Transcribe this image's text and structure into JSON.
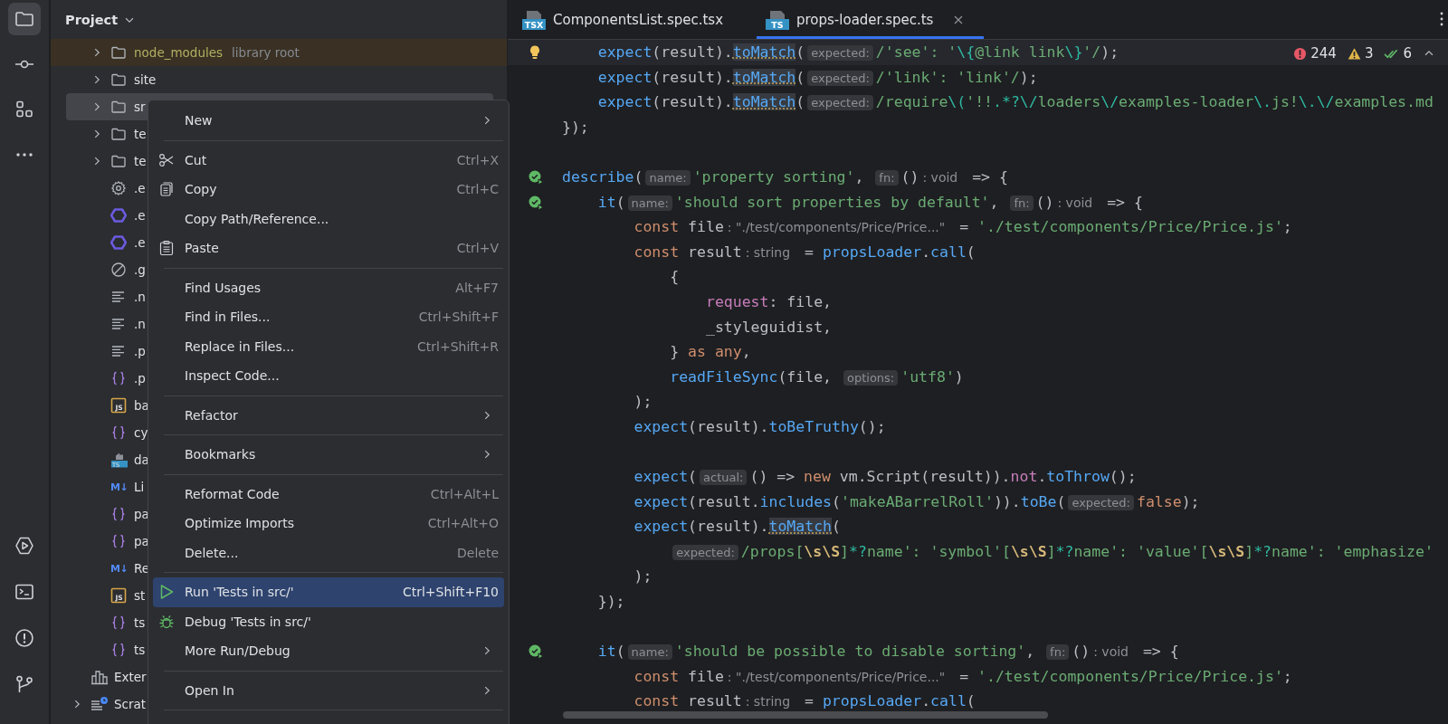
{
  "tool_strip": {
    "top": [
      {
        "kind": "project",
        "selected": true
      },
      {
        "kind": "commit",
        "selected": false
      },
      {
        "kind": "structure",
        "selected": false
      },
      {
        "kind": "more",
        "selected": false
      }
    ],
    "bottom": [
      {
        "kind": "run",
        "selected": false
      },
      {
        "kind": "terminal",
        "selected": false
      },
      {
        "kind": "problems",
        "selected": false
      },
      {
        "kind": "git",
        "selected": false
      }
    ]
  },
  "project": {
    "title": "Project",
    "items": [
      {
        "kind": "folder",
        "label": "node_modules",
        "note": "library root",
        "library": true,
        "expanded": false,
        "selected": false
      },
      {
        "kind": "folder",
        "label": "site",
        "library": false,
        "expanded": false,
        "selected": false
      },
      {
        "kind": "folder",
        "label": "sr",
        "library": false,
        "expanded": false,
        "selected": true
      },
      {
        "kind": "folder",
        "label": "te",
        "library": false,
        "expanded": false,
        "selected": false
      },
      {
        "kind": "folder",
        "label": "te",
        "library": false,
        "expanded": false,
        "selected": false
      },
      {
        "kind": "gear",
        "label": ".e",
        "library": false,
        "selected": false
      },
      {
        "kind": "hex",
        "label": ".e",
        "library": false,
        "selected": false
      },
      {
        "kind": "hex",
        "label": ".e",
        "library": false,
        "selected": false
      },
      {
        "kind": "block",
        "label": ".g",
        "library": false,
        "selected": false
      },
      {
        "kind": "lines",
        "label": ".n",
        "library": false,
        "selected": false
      },
      {
        "kind": "lines",
        "label": ".n",
        "library": false,
        "selected": false
      },
      {
        "kind": "lines",
        "label": ".p",
        "library": false,
        "selected": false
      },
      {
        "kind": "braces",
        "label": ".p",
        "library": false,
        "selected": false
      },
      {
        "kind": "js",
        "icon_text": "JS",
        "label": "ba",
        "library": false,
        "selected": false
      },
      {
        "kind": "braces",
        "label": "cy",
        "library": false,
        "selected": false
      },
      {
        "kind": "tsdb",
        "icon_text": "TS",
        "label": "da",
        "library": false,
        "selected": false
      },
      {
        "kind": "md",
        "icon_text": "M↓",
        "label": "Li",
        "library": false,
        "selected": false
      },
      {
        "kind": "braces",
        "label": "pa",
        "library": false,
        "selected": false
      },
      {
        "kind": "braces",
        "label": "pa",
        "library": false,
        "selected": false
      },
      {
        "kind": "md",
        "icon_text": "M↓",
        "label": "Re",
        "library": false,
        "selected": false
      },
      {
        "kind": "js",
        "icon_text": "JS",
        "label": "st",
        "library": false,
        "selected": false
      },
      {
        "kind": "braces",
        "label": "ts",
        "library": false,
        "selected": false
      },
      {
        "kind": "braces",
        "label": "ts",
        "library": false,
        "selected": false
      }
    ],
    "root_items": [
      {
        "kind": "library",
        "label": "Exter",
        "selected": false
      },
      {
        "kind": "scratch",
        "label": "Scrat",
        "expanded": false,
        "selected": false
      }
    ]
  },
  "editor": {
    "tabs": [
      {
        "label": "ComponentsList.spec.tsx",
        "icon_text": "TSX",
        "selected": false,
        "closable": false
      },
      {
        "label": "props-loader.spec.ts",
        "icon_text": "TS",
        "selected": true,
        "closable": true
      }
    ],
    "issues": {
      "errors": "244",
      "warnings": "3",
      "passed": "6"
    },
    "lines": [
      {
        "kind": "bulb",
        "current": true,
        "tokens": [
          {
            "kind": "fn",
            "text": "    expect"
          },
          {
            "kind": "plain",
            "text": "(result)."
          },
          {
            "kind": "match",
            "text": "toMatch"
          },
          {
            "kind": "plain",
            "text": "("
          },
          {
            "kind": "hint",
            "text": "expected:"
          },
          {
            "kind": "str",
            "text": "/'see': '"
          },
          {
            "kind": "esc",
            "text": "\\{"
          },
          {
            "kind": "str",
            "text": "@link link"
          },
          {
            "kind": "esc",
            "text": "\\}"
          },
          {
            "kind": "str",
            "text": "'/"
          },
          {
            "kind": "plain",
            "text": ");"
          }
        ]
      },
      {
        "kind": "code",
        "current": false,
        "tokens": [
          {
            "kind": "fn",
            "text": "    expect"
          },
          {
            "kind": "plain",
            "text": "(result)."
          },
          {
            "kind": "match",
            "text": "toMatch"
          },
          {
            "kind": "plain",
            "text": "("
          },
          {
            "kind": "hint",
            "text": "expected:"
          },
          {
            "kind": "str",
            "text": "/'link': 'link'/"
          },
          {
            "kind": "plain",
            "text": ");"
          }
        ]
      },
      {
        "kind": "code",
        "current": false,
        "tokens": [
          {
            "kind": "fn",
            "text": "    expect"
          },
          {
            "kind": "plain",
            "text": "(result)."
          },
          {
            "kind": "match",
            "text": "toMatch"
          },
          {
            "kind": "plain",
            "text": "("
          },
          {
            "kind": "hint",
            "text": "expected:"
          },
          {
            "kind": "str",
            "text": "/require"
          },
          {
            "kind": "esc",
            "text": "\\("
          },
          {
            "kind": "str",
            "text": "'!!"
          },
          {
            "kind": "esc",
            "text": ".*?\\/"
          },
          {
            "kind": "str",
            "text": "loaders"
          },
          {
            "kind": "esc",
            "text": "\\/"
          },
          {
            "kind": "str",
            "text": "examples-loader"
          },
          {
            "kind": "esc",
            "text": "\\."
          },
          {
            "kind": "str",
            "text": "js!"
          },
          {
            "kind": "esc",
            "text": "\\.\\/"
          },
          {
            "kind": "str",
            "text": "examples.md"
          }
        ]
      },
      {
        "kind": "code",
        "current": false,
        "tokens": [
          {
            "kind": "plain",
            "text": "});"
          }
        ]
      },
      {
        "kind": "code",
        "current": false
      },
      {
        "kind": "run",
        "current": false,
        "tokens": [
          {
            "kind": "fn",
            "text": "describe"
          },
          {
            "kind": "plain",
            "text": "("
          },
          {
            "kind": "hint",
            "text": "name:"
          },
          {
            "kind": "str",
            "text": "'property sorting'"
          },
          {
            "kind": "plain",
            "text": ", "
          },
          {
            "kind": "hint",
            "text": "fn:"
          },
          {
            "kind": "plain",
            "text": "()"
          },
          {
            "kind": "type",
            "text": ": void"
          },
          {
            "kind": "plain",
            "text": " => {"
          }
        ]
      },
      {
        "kind": "run",
        "current": false,
        "tokens": [
          {
            "kind": "fn",
            "text": "    it"
          },
          {
            "kind": "plain",
            "text": "("
          },
          {
            "kind": "hint",
            "text": "name:"
          },
          {
            "kind": "str",
            "text": "'should sort properties by default'"
          },
          {
            "kind": "plain",
            "text": ", "
          },
          {
            "kind": "hint",
            "text": "fn:"
          },
          {
            "kind": "plain",
            "text": "()"
          },
          {
            "kind": "type",
            "text": ": void"
          },
          {
            "kind": "plain",
            "text": " => {"
          }
        ]
      },
      {
        "kind": "code",
        "current": false,
        "tokens": [
          {
            "kind": "kw",
            "text": "        const"
          },
          {
            "kind": "plain",
            "text": " file"
          },
          {
            "kind": "type",
            "text": ": \"./test/components/Price/Price...\""
          },
          {
            "kind": "plain",
            "text": " = "
          },
          {
            "kind": "str",
            "text": "'./test/components/Price/Price.js'"
          },
          {
            "kind": "plain",
            "text": ";"
          }
        ]
      },
      {
        "kind": "code",
        "current": false,
        "tokens": [
          {
            "kind": "kw",
            "text": "        const"
          },
          {
            "kind": "plain",
            "text": " result"
          },
          {
            "kind": "type",
            "text": ": string"
          },
          {
            "kind": "plain",
            "text": " = "
          },
          {
            "kind": "fn",
            "text": "propsLoader"
          },
          {
            "kind": "plain",
            "text": "."
          },
          {
            "kind": "fn",
            "text": "call"
          },
          {
            "kind": "plain",
            "text": "("
          }
        ]
      },
      {
        "kind": "code",
        "current": false,
        "tokens": [
          {
            "kind": "plain",
            "text": "            {"
          }
        ]
      },
      {
        "kind": "code",
        "current": false,
        "tokens": [
          {
            "kind": "prop",
            "text": "                request"
          },
          {
            "kind": "plain",
            "text": ": file,"
          }
        ]
      },
      {
        "kind": "code",
        "current": false,
        "tokens": [
          {
            "kind": "plain",
            "text": "                _styleguidist,"
          }
        ]
      },
      {
        "kind": "code",
        "current": false,
        "tokens": [
          {
            "kind": "plain",
            "text": "            } "
          },
          {
            "kind": "kw",
            "text": "as any"
          },
          {
            "kind": "plain",
            "text": ","
          }
        ]
      },
      {
        "kind": "code",
        "current": false,
        "tokens": [
          {
            "kind": "fn",
            "text": "            readFileSync"
          },
          {
            "kind": "plain",
            "text": "(file, "
          },
          {
            "kind": "hint",
            "text": "options:"
          },
          {
            "kind": "str",
            "text": "'utf8'"
          },
          {
            "kind": "plain",
            "text": ")"
          }
        ]
      },
      {
        "kind": "code",
        "current": false,
        "tokens": [
          {
            "kind": "plain",
            "text": "        );"
          }
        ]
      },
      {
        "kind": "code",
        "current": false,
        "tokens": [
          {
            "kind": "fn",
            "text": "        expect"
          },
          {
            "kind": "plain",
            "text": "(result)."
          },
          {
            "kind": "fn",
            "text": "toBeTruthy"
          },
          {
            "kind": "plain",
            "text": "();"
          }
        ]
      },
      {
        "kind": "code",
        "current": false
      },
      {
        "kind": "code",
        "current": false,
        "tokens": [
          {
            "kind": "fn",
            "text": "        expect"
          },
          {
            "kind": "plain",
            "text": "("
          },
          {
            "kind": "hint",
            "text": "actual:"
          },
          {
            "kind": "plain",
            "text": "() => "
          },
          {
            "kind": "kw",
            "text": "new"
          },
          {
            "kind": "plain",
            "text": " vm.Script(result))."
          },
          {
            "kind": "prop",
            "text": "not"
          },
          {
            "kind": "plain",
            "text": "."
          },
          {
            "kind": "fn",
            "text": "toThrow"
          },
          {
            "kind": "plain",
            "text": "();"
          }
        ]
      },
      {
        "kind": "code",
        "current": false,
        "tokens": [
          {
            "kind": "fn",
            "text": "        expect"
          },
          {
            "kind": "plain",
            "text": "(result."
          },
          {
            "kind": "fn",
            "text": "includes"
          },
          {
            "kind": "plain",
            "text": "("
          },
          {
            "kind": "str",
            "text": "'makeABarrelRoll'"
          },
          {
            "kind": "plain",
            "text": "))."
          },
          {
            "kind": "fn",
            "text": "toBe"
          },
          {
            "kind": "plain",
            "text": "("
          },
          {
            "kind": "hint",
            "text": "expected:"
          },
          {
            "kind": "kw",
            "text": "false"
          },
          {
            "kind": "plain",
            "text": ");"
          }
        ]
      },
      {
        "kind": "code",
        "current": false,
        "tokens": [
          {
            "kind": "fn",
            "text": "        expect"
          },
          {
            "kind": "plain",
            "text": "(result)."
          },
          {
            "kind": "match",
            "text": "toMatch"
          },
          {
            "kind": "plain",
            "text": "("
          }
        ]
      },
      {
        "kind": "code",
        "current": false,
        "tokens": [
          {
            "kind": "hint",
            "text": "            expected:"
          },
          {
            "kind": "str",
            "text": "/props["
          },
          {
            "kind": "cls",
            "text": "\\s\\S"
          },
          {
            "kind": "str",
            "text": "]"
          },
          {
            "kind": "esc",
            "text": "*?"
          },
          {
            "kind": "str",
            "text": "name': 'symbol'["
          },
          {
            "kind": "cls",
            "text": "\\s\\S"
          },
          {
            "kind": "str",
            "text": "]"
          },
          {
            "kind": "esc",
            "text": "*?"
          },
          {
            "kind": "str",
            "text": "name': 'value'["
          },
          {
            "kind": "cls",
            "text": "\\s\\S"
          },
          {
            "kind": "str",
            "text": "]"
          },
          {
            "kind": "esc",
            "text": "*?"
          },
          {
            "kind": "str",
            "text": "name': 'emphasize'"
          }
        ]
      },
      {
        "kind": "code",
        "current": false,
        "tokens": [
          {
            "kind": "plain",
            "text": "        );"
          }
        ]
      },
      {
        "kind": "code",
        "current": false,
        "tokens": [
          {
            "kind": "plain",
            "text": "    });"
          }
        ]
      },
      {
        "kind": "code",
        "current": false
      },
      {
        "kind": "run",
        "current": false,
        "tokens": [
          {
            "kind": "fn",
            "text": "    it"
          },
          {
            "kind": "plain",
            "text": "("
          },
          {
            "kind": "hint",
            "text": "name:"
          },
          {
            "kind": "str",
            "text": "'should be possible to disable sorting'"
          },
          {
            "kind": "plain",
            "text": ", "
          },
          {
            "kind": "hint",
            "text": "fn:"
          },
          {
            "kind": "plain",
            "text": "()"
          },
          {
            "kind": "type",
            "text": ": void"
          },
          {
            "kind": "plain",
            "text": " => {"
          }
        ]
      },
      {
        "kind": "code",
        "current": false,
        "tokens": [
          {
            "kind": "kw",
            "text": "        const"
          },
          {
            "kind": "plain",
            "text": " file"
          },
          {
            "kind": "type",
            "text": ": \"./test/components/Price/Price...\""
          },
          {
            "kind": "plain",
            "text": " = "
          },
          {
            "kind": "str",
            "text": "'./test/components/Price/Price.js'"
          },
          {
            "kind": "plain",
            "text": ";"
          }
        ]
      },
      {
        "kind": "code",
        "current": false,
        "tokens": [
          {
            "kind": "kw",
            "text": "        const"
          },
          {
            "kind": "plain",
            "text": " result"
          },
          {
            "kind": "type",
            "text": ": string"
          },
          {
            "kind": "plain",
            "text": " = "
          },
          {
            "kind": "fn",
            "text": "propsLoader"
          },
          {
            "kind": "plain",
            "text": "."
          },
          {
            "kind": "fn",
            "text": "call"
          },
          {
            "kind": "plain",
            "text": "("
          }
        ]
      }
    ]
  },
  "context_menu": {
    "items": [
      {
        "kind": "item",
        "label": "New",
        "submenu": true,
        "selected": false
      },
      {
        "kind": "separator"
      },
      {
        "kind": "cut",
        "label": "Cut",
        "shortcut": "Ctrl+X",
        "submenu": false,
        "selected": false
      },
      {
        "kind": "copy",
        "label": "Copy",
        "shortcut": "Ctrl+C",
        "submenu": false,
        "selected": false
      },
      {
        "kind": "item",
        "label": "Copy Path/Reference...",
        "submenu": false,
        "selected": false
      },
      {
        "kind": "paste",
        "label": "Paste",
        "shortcut": "Ctrl+V",
        "submenu": false,
        "selected": false
      },
      {
        "kind": "separator"
      },
      {
        "kind": "item",
        "label": "Find Usages",
        "shortcut": "Alt+F7",
        "submenu": false,
        "selected": false
      },
      {
        "kind": "item",
        "label": "Find in Files...",
        "shortcut": "Ctrl+Shift+F",
        "submenu": false,
        "selected": false
      },
      {
        "kind": "item",
        "label": "Replace in Files...",
        "shortcut": "Ctrl+Shift+R",
        "submenu": false,
        "selected": false
      },
      {
        "kind": "item",
        "label": "Inspect Code...",
        "submenu": false,
        "selected": false
      },
      {
        "kind": "separator"
      },
      {
        "kind": "item",
        "label": "Refactor",
        "submenu": true,
        "selected": false
      },
      {
        "kind": "separator"
      },
      {
        "kind": "item",
        "label": "Bookmarks",
        "submenu": true,
        "selected": false
      },
      {
        "kind": "separator"
      },
      {
        "kind": "item",
        "label": "Reformat Code",
        "shortcut": "Ctrl+Alt+L",
        "submenu": false,
        "selected": false
      },
      {
        "kind": "item",
        "label": "Optimize Imports",
        "shortcut": "Ctrl+Alt+O",
        "submenu": false,
        "selected": false
      },
      {
        "kind": "item",
        "label": "Delete...",
        "shortcut": "Delete",
        "submenu": false,
        "selected": false
      },
      {
        "kind": "separator"
      },
      {
        "kind": "run",
        "label": "Run 'Tests in src/'",
        "shortcut": "Ctrl+Shift+F10",
        "submenu": false,
        "selected": true
      },
      {
        "kind": "debug",
        "label": "Debug 'Tests in src/'",
        "submenu": false,
        "selected": false
      },
      {
        "kind": "item",
        "label": "More Run/Debug",
        "submenu": true,
        "selected": false
      },
      {
        "kind": "separator"
      },
      {
        "kind": "item",
        "label": "Open In",
        "submenu": true,
        "selected": false
      },
      {
        "kind": "separator"
      }
    ]
  }
}
